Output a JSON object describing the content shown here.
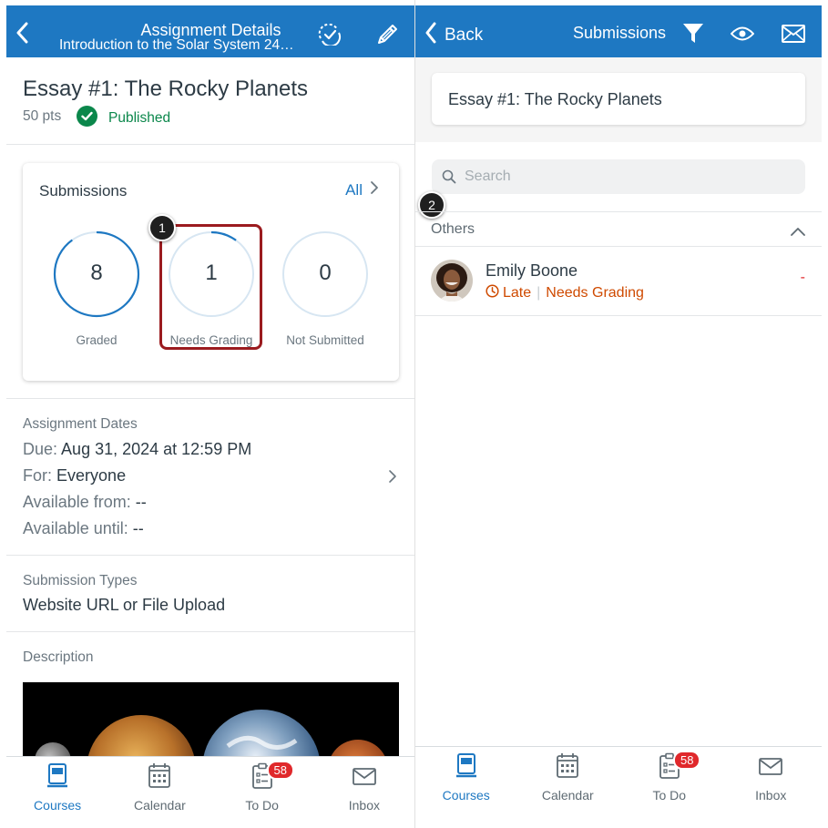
{
  "left": {
    "header": {
      "title": "Assignment Details",
      "subtitle": "Introduction to the Solar System  24…"
    },
    "assignment": {
      "title": "Essay #1: The Rocky Planets",
      "points": "50 pts",
      "status": "Published"
    },
    "submissions": {
      "title": "Submissions",
      "all_label": "All",
      "stats": [
        {
          "value": "8",
          "label": "Graded",
          "progress": 0.9
        },
        {
          "value": "1",
          "label": "Needs Grading",
          "progress": 0.1
        },
        {
          "value": "0",
          "label": "Not Submitted",
          "progress": 0
        }
      ]
    },
    "callout": "1",
    "dates": {
      "section_label": "Assignment Dates",
      "due_label": "Due:",
      "due_value": "Aug 31, 2024 at 12:59 PM",
      "for_label": "For:",
      "for_value": "Everyone",
      "available_from_label": "Available from:",
      "available_from_value": "--",
      "available_until_label": "Available until:",
      "available_until_value": "--"
    },
    "submission_types": {
      "section_label": "Submission Types",
      "value": "Website URL or File Upload"
    },
    "description": {
      "section_label": "Description"
    }
  },
  "right": {
    "header": {
      "back_label": "Back",
      "title": "Submissions"
    },
    "assignment_title": "Essay #1: The Rocky Planets",
    "search": {
      "placeholder": "Search"
    },
    "callout": "2",
    "group": {
      "label": "Others"
    },
    "students": [
      {
        "name": "Emily Boone",
        "status_late": "Late",
        "status_grading": "Needs Grading",
        "grade": "-"
      }
    ]
  },
  "tabbar": {
    "tabs": [
      {
        "label": "Courses",
        "icon": "courses-icon",
        "active": true
      },
      {
        "label": "Calendar",
        "icon": "calendar-icon"
      },
      {
        "label": "To Do",
        "icon": "todo-icon",
        "badge": "58"
      },
      {
        "label": "Inbox",
        "icon": "inbox-icon"
      }
    ]
  },
  "colors": {
    "brand_blue": "#1e78c2",
    "published_green": "#0b874b",
    "highlight_red": "#9b1b1f",
    "late_orange": "#cf4a00",
    "badge_red": "#e0282b"
  }
}
